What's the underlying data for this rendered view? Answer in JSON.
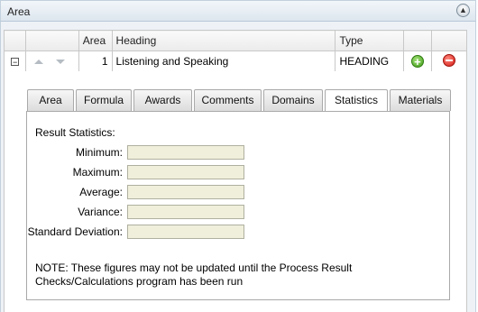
{
  "panel": {
    "title": "Area"
  },
  "grid": {
    "headers": {
      "area": "Area",
      "heading": "Heading",
      "type": "Type"
    },
    "row": {
      "expander": "−",
      "area": "1",
      "heading": "Listening and Speaking",
      "type": "HEADING"
    }
  },
  "tabs": [
    {
      "label": "Area",
      "active": false
    },
    {
      "label": "Formula",
      "active": false
    },
    {
      "label": "Awards",
      "active": false
    },
    {
      "label": "Comments",
      "active": false
    },
    {
      "label": "Domains",
      "active": false
    },
    {
      "label": "Statistics",
      "active": true
    },
    {
      "label": "Materials",
      "active": false
    }
  ],
  "statistics": {
    "title": "Result Statistics:",
    "fields": [
      {
        "label": "Minimum:",
        "value": ""
      },
      {
        "label": "Maximum:",
        "value": ""
      },
      {
        "label": "Average:",
        "value": ""
      },
      {
        "label": "Variance:",
        "value": ""
      },
      {
        "label": "Standard Deviation:",
        "value": ""
      }
    ],
    "note": "NOTE: These figures may not be updated until the Process Result Checks/Calculations program has been run"
  },
  "colors": {
    "header_border": "#c3d1de",
    "field_bg": "#efefdc",
    "add": "#3e9b16",
    "delete": "#d31a12"
  },
  "icons": {
    "collapse": "chevron-up-icon",
    "add": "add-icon",
    "delete": "delete-icon",
    "move_up": "arrow-up-icon",
    "move_down": "arrow-down-icon"
  }
}
